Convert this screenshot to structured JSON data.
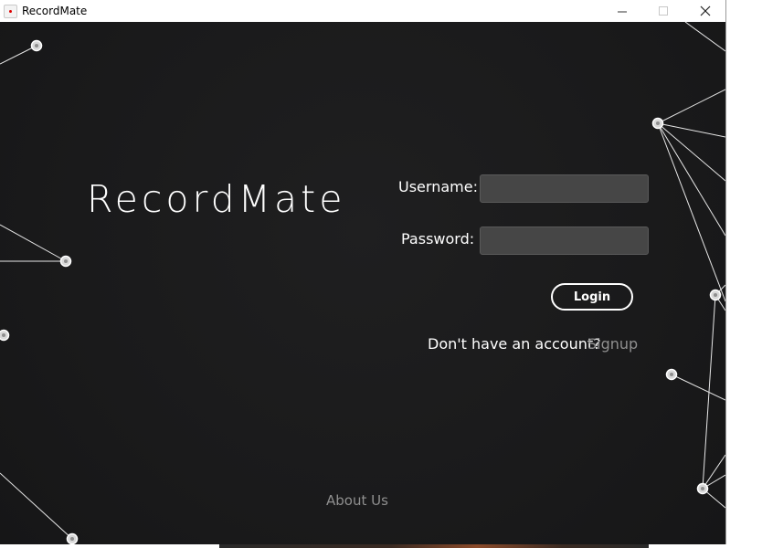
{
  "window": {
    "title": "RecordMate",
    "controls": {
      "minimize": "minimize-icon",
      "maximize": "maximize-icon",
      "close": "close-icon"
    }
  },
  "brand": {
    "name": "RecordMate"
  },
  "login_form": {
    "username_label": "Username:",
    "username_value": "",
    "password_label": "Password:",
    "password_value": "",
    "login_button": "Login",
    "signup_prompt": "Don't have an account?",
    "signup_link": "Signup"
  },
  "footer": {
    "about_link": "About Us"
  },
  "colors": {
    "background": "#1b1b1c",
    "input_fill": "#464646",
    "link_muted": "#8f8f8f",
    "text": "#ffffff"
  }
}
